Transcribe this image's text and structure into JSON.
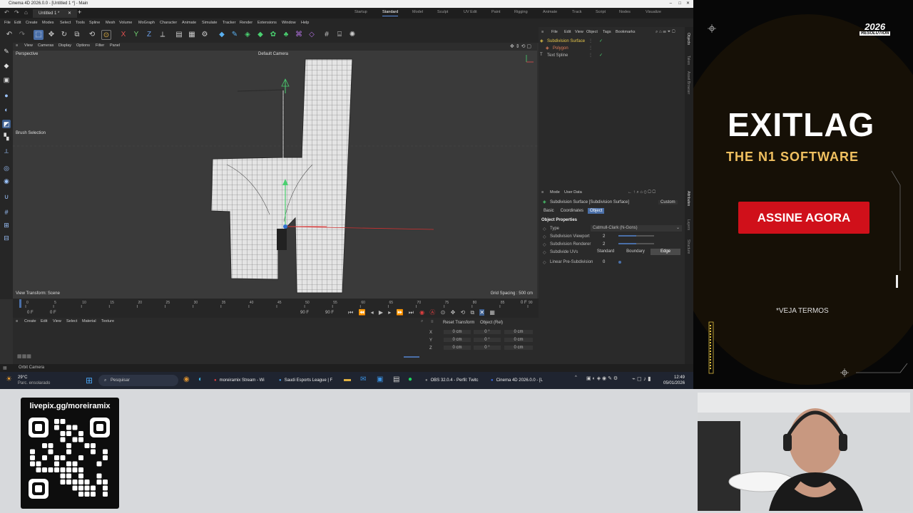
{
  "window": {
    "title": "Cinema 4D 2026.0.0 - [Untitled 1 *] - Main",
    "tab_label": "Untitled 1 *",
    "layout_tabs": [
      "Startup",
      "Standard",
      "Model",
      "Sculpt",
      "UV Edit",
      "Paint",
      "Rigging",
      "Animate",
      "Track",
      "Script",
      "Nodes",
      "Visualize"
    ],
    "active_layout": "Standard"
  },
  "menubar": [
    "File",
    "Edit",
    "Create",
    "Modes",
    "Select",
    "Tools",
    "Spline",
    "Mesh",
    "Volume",
    "MoGraph",
    "Character",
    "Animate",
    "Simulate",
    "Tracker",
    "Render",
    "Extensions",
    "Window",
    "Help"
  ],
  "toolbar_axes": [
    "X",
    "Y",
    "Z"
  ],
  "viewport": {
    "menu": [
      "View",
      "Cameras",
      "Display",
      "Options",
      "Filter",
      "Panel"
    ],
    "label": "Perspective",
    "camera": "Default Camera",
    "brush_label": "Brush Selection",
    "transform_label": "View Transform: Scene",
    "grid_label": "Grid Spacing : 500 cm"
  },
  "timeline": {
    "ruler": [
      "0",
      "5",
      "10",
      "15",
      "20",
      "25",
      "30",
      "35",
      "40",
      "45",
      "50",
      "55",
      "60",
      "65",
      "70",
      "75",
      "80",
      "85",
      "90"
    ],
    "start_frame": "0 F",
    "current_frame": "0 F",
    "end_frame": "90 F",
    "end_frame_field": "90 F",
    "right_field": "0 F"
  },
  "material_manager": {
    "menu": [
      "Create",
      "Edit",
      "View",
      "Select",
      "Material",
      "Texture"
    ]
  },
  "coordinates": {
    "reset_button": "Reset Transform",
    "mode_select": "Object (Rel)",
    "rows": [
      {
        "axis": "X",
        "pos": "0 cm",
        "rot": "0 °",
        "size": "0 cm"
      },
      {
        "axis": "Y",
        "pos": "0 cm",
        "rot": "0 °",
        "size": "0 cm"
      },
      {
        "axis": "Z",
        "pos": "0 cm",
        "rot": "0 °",
        "size": "0 cm"
      }
    ]
  },
  "status": {
    "text": "Orbit Camera"
  },
  "object_manager": {
    "menu": [
      "File",
      "Edit",
      "View",
      "Object",
      "Tags",
      "Bookmarks"
    ],
    "objects": [
      {
        "name": "Subdivision Surface",
        "color": "#e8c84a"
      },
      {
        "name": "Polygon",
        "color": "#e07d5a"
      },
      {
        "name": "Text Spline",
        "color": "#bbbbbb"
      }
    ]
  },
  "attributes": {
    "menu": [
      "Mode",
      "User Data"
    ],
    "object_title": "Subdivision Surface [Subdivision Surface]",
    "preset": "Custom",
    "tabs": [
      "Basic",
      "Coordinates",
      "Object"
    ],
    "active_tab": "Object",
    "section": "Object Properties",
    "type_label": "Type",
    "type_value": "Catmull-Clark (N-Gons)",
    "viewport_label": "Subdivision Viewport",
    "viewport_value": "2",
    "viewport_level": 0.5,
    "renderer_label": "Subdivision Renderer",
    "renderer_value": "2",
    "renderer_level": 0.5,
    "uvs_label": "Subdivide UVs",
    "uv_options": [
      "Standard",
      "Boundary",
      "Edge"
    ],
    "uv_selected": "Edge",
    "linear_label": "Linear Pre-Subdivision",
    "linear_value": "0"
  },
  "side_tabs": [
    "Objects",
    "Takes",
    "Asset Browser",
    "Attributes",
    "Layers",
    "Structure"
  ],
  "taskbar": {
    "weather_temp": "29°C",
    "weather_desc": "Parc. ensolarado",
    "search_placeholder": "Pesquisar",
    "apps": [
      "moreiramix Stream - Wi",
      "Saudi Esports League | F",
      "OBS 32.0.4 - Perfil: Twitc",
      "Cinema 4D 2026.0.0 - [L"
    ],
    "time": "12:49",
    "date": "05/01/2026"
  },
  "ad": {
    "badge_top": "2026",
    "badge_bottom": "RESOLUTION",
    "brand": "EXITLAG",
    "tagline": "THE N1 SOFTWARE",
    "cta": "ASSINE AGORA",
    "terms": "*VEJA TERMOS",
    "accent": "#d0101a"
  },
  "overlay": {
    "url": "livepix.gg/moreiramix"
  }
}
